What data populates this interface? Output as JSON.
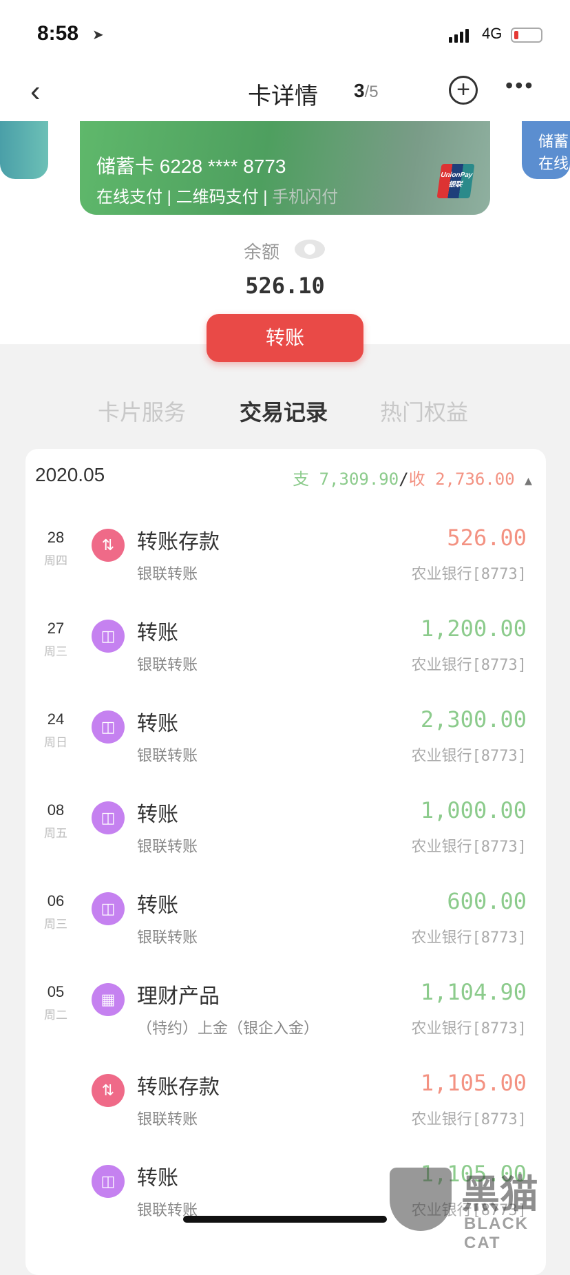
{
  "status": {
    "time": "8:58",
    "network": "4G"
  },
  "nav": {
    "title": "卡详情",
    "page_current": "3",
    "page_total": "/5"
  },
  "card": {
    "number": "储蓄卡 6228 **** 8773",
    "features": [
      "在线支付",
      "二维码支付",
      "手机闪付"
    ],
    "brand": "UnionPay 银联",
    "next_card_lines": [
      "储蓄",
      "在线"
    ]
  },
  "balance": {
    "label": "余额",
    "value": "526.10"
  },
  "transfer_label": "转账",
  "tabs": [
    "卡片服务",
    "交易记录",
    "热门权益"
  ],
  "list": {
    "month": "2020.05",
    "expense_label": "支",
    "expense": "7,309.90",
    "sep": "/",
    "income_label": "收",
    "income": "2,736.00",
    "rows": [
      {
        "day": "28",
        "weekday": "周四",
        "icon": "transfer-deposit",
        "title": "转账存款",
        "sub": "银联转账",
        "amount": "526.00",
        "type": "in",
        "bank": "农业银行[8773]"
      },
      {
        "day": "27",
        "weekday": "周三",
        "icon": "shopping-bag",
        "title": "转账",
        "sub": "银联转账",
        "amount": "1,200.00",
        "type": "out",
        "bank": "农业银行[8773]"
      },
      {
        "day": "24",
        "weekday": "周日",
        "icon": "shopping-bag",
        "title": "转账",
        "sub": "银联转账",
        "amount": "2,300.00",
        "type": "out",
        "bank": "农业银行[8773]"
      },
      {
        "day": "08",
        "weekday": "周五",
        "icon": "shopping-bag",
        "title": "转账",
        "sub": "银联转账",
        "amount": "1,000.00",
        "type": "out",
        "bank": "农业银行[8773]"
      },
      {
        "day": "06",
        "weekday": "周三",
        "icon": "shopping-bag",
        "title": "转账",
        "sub": "银联转账",
        "amount": "600.00",
        "type": "out",
        "bank": "农业银行[8773]"
      },
      {
        "day": "05",
        "weekday": "周二",
        "icon": "calculator",
        "title": "理财产品",
        "sub": "（特约）上金（银企入金）",
        "amount": "1,104.90",
        "type": "out",
        "bank": "农业银行[8773]"
      },
      {
        "day": "",
        "weekday": "",
        "icon": "transfer-deposit",
        "title": "转账存款",
        "sub": "银联转账",
        "amount": "1,105.00",
        "type": "in",
        "bank": "农业银行[8773]"
      },
      {
        "day": "",
        "weekday": "",
        "icon": "shopping-bag",
        "title": "转账",
        "sub": "银联转账",
        "amount": "1,105.00",
        "type": "out",
        "bank": "农业银行[8773]"
      }
    ]
  },
  "watermark": {
    "text": "黑猫",
    "sub": "BLACK CAT"
  },
  "colors": {
    "expense": "#8ccb8c",
    "income": "#f39282",
    "button": "#e94a47"
  }
}
